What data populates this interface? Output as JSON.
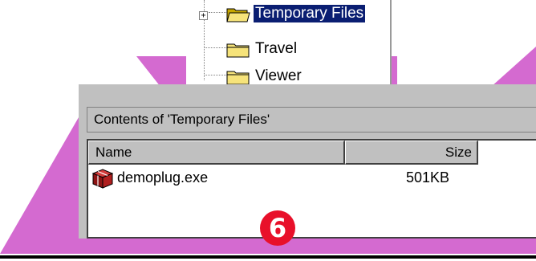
{
  "tree": {
    "items": [
      {
        "label": "Temporary Files",
        "selected": true,
        "expandable": true,
        "expander": "+"
      },
      {
        "label": "Travel",
        "selected": false,
        "expandable": false
      },
      {
        "label": "Viewer",
        "selected": false,
        "expandable": false
      }
    ]
  },
  "panel": {
    "title": "Contents of 'Temporary Files'",
    "columns": {
      "name": "Name",
      "size": "Size"
    },
    "files": [
      {
        "name": "demoplug.exe",
        "size": "501KB",
        "icon": "package-icon"
      }
    ]
  },
  "step_badge": "6",
  "colors": {
    "backdrop_magenta": "#d46ad0",
    "selection": "#0a1e72",
    "badge": "#e8102a",
    "chrome": "#c0c0c0"
  }
}
